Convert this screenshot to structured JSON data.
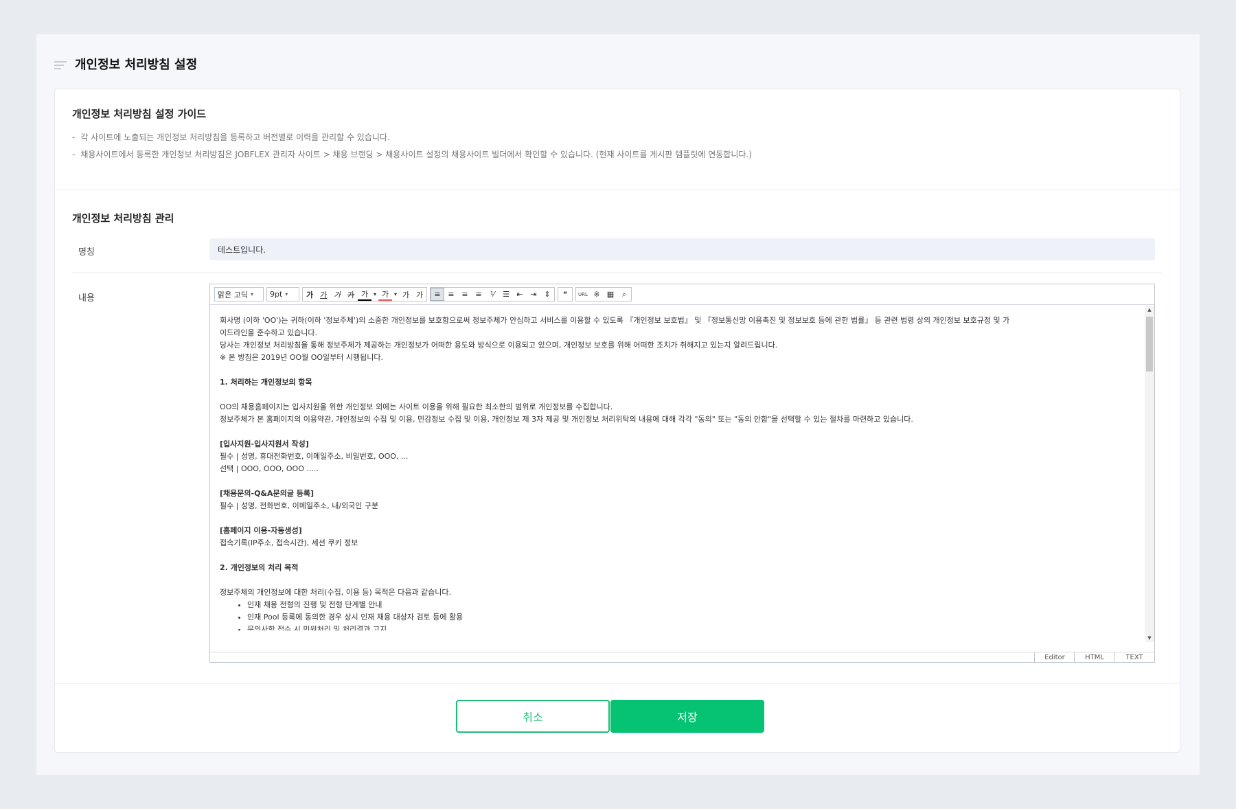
{
  "page": {
    "title": "개인정보 처리방침 설정"
  },
  "guide": {
    "title": "개인정보 처리방침 설정 가이드",
    "lines": [
      "각 사이트에 노출되는 개인정보 처리방침을 등록하고 버전별로 이력을 관리할 수 있습니다.",
      "채용사이트에서 등록한 개인정보 처리방침은 JOBFLEX 관리자 사이트 > 채용 브랜딩 > 채용사이트 설정의 채용사이트 빌더에서 확인할 수 있습니다. (현재 사이트를 게시판 템플릿에 연동합니다.)"
    ]
  },
  "management": {
    "title": "개인정보 처리방침 관리",
    "name_label": "명칭",
    "name_value": "테스트입니다.",
    "content_label": "내용"
  },
  "editor": {
    "font_select": "맑은 고딕",
    "size_select": "9pt",
    "toolbar_icons": [
      "bold-icon",
      "underline-icon",
      "italic-icon",
      "strikethrough-icon",
      "text-color-icon",
      "highlight-icon",
      "superscript-icon",
      "subscript-icon",
      "align-left-icon",
      "align-center-icon",
      "align-right-icon",
      "align-justify-icon",
      "ordered-list-icon",
      "bullet-list-icon",
      "outdent-icon",
      "indent-icon",
      "line-height-icon",
      "quote-icon",
      "link-icon",
      "special-char-icon",
      "table-icon",
      "find-icon"
    ],
    "toolbar_glyphs": {
      "bold": "가",
      "underline": "가",
      "italic": "가",
      "strike": "가",
      "color": "가",
      "highlight": "가",
      "sup": "가",
      "sub": "가",
      "quote": "❝",
      "url": "URL",
      "special": "※",
      "table": "▦",
      "find": "⌕",
      "align_left": "≡",
      "align_center": "≡",
      "align_right": "≡",
      "align_justify": "≡",
      "ol": "⅟",
      "ul": "☰",
      "outdent": "⇤",
      "indent": "⇥",
      "line_height": "⇕"
    },
    "content": {
      "intro_1": "회사명 (이하 'OO')는 귀하(이하 '정보주체')의 소중한 개인정보를 보호함으로써 정보주체가 안심하고 서비스를 이용할 수 있도록 『개인정보 보호법』 및 『정보통신망 이용촉진 및 정보보호 등에 관한 법률』 등 관련 법령 상의 개인정보 보호규정 및 가",
      "intro_2": "이드라인을 준수하고 있습니다.",
      "intro_3": "당사는 개인정보 처리방침을 통해 정보주체가 제공하는 개인정보가 어떠한 용도와 방식으로 이용되고 있으며, 개인정보 보호를 위해 어떠한 조치가 취해지고 있는지 알려드립니다.",
      "intro_4": "※ 본 방침은 2019년 OO월 OO일부터 시행됩니다.",
      "h1": "1. 처리하는 개인정보의 항목",
      "p1_1": "OO의 채용홈페이지는 입사지원을 위한 개인정보 외에는 사이트 이용을 위해 필요한 최소한의 범위로 개인정보를 수집합니다.",
      "p1_2": "정보주체가 본 홈페이지의 이용약관, 개인정보의 수집 및 이용, 민감정보 수집 및 이용, 개인정보 제 3자 제공 및 개인정보 처리위탁의 내용에 대해 각각 \"동의\" 또는 \"동의 안함\"을 선택할 수 있는 절차를 마련하고 있습니다.",
      "s1_title": "[입사지원-입사지원서 작성]",
      "s1_req": "필수 | 성명, 휴대전화번호, 이메일주소, 비밀번호, OOO, ...",
      "s1_opt": "선택 | OOO, OOO, OOO .....",
      "s2_title": "[채용문의-Q&A문의글 등록]",
      "s2_req": "필수 | 성명, 전화번호, 이메일주소, 내/외국인 구분",
      "s3_title": "[홈페이지 이용-자동생성]",
      "s3_body": "접속기록(IP주소, 접속시간), 세션 쿠키 정보",
      "h2": "2. 개인정보의 처리 목적",
      "p2": "정보주체의 개인정보에 대한 처리(수집, 이용 등) 목적은 다음과 같습니다.",
      "li": [
        "인재 채용 전형의 진행 및 전형 단계별 안내",
        "인재 Pool 등록에 동의한 경우 상시 인재 채용 대상자 검토 등에 활용",
        "문의사항 접수 시 민원처리 및 처리결과 고지"
      ]
    },
    "modes": [
      "Editor",
      "HTML",
      "TEXT"
    ]
  },
  "actions": {
    "cancel": "취소",
    "save": "저장"
  },
  "colors": {
    "primary": "#06c273",
    "background": "#e8ebef",
    "panel": "#f5f7fa"
  }
}
